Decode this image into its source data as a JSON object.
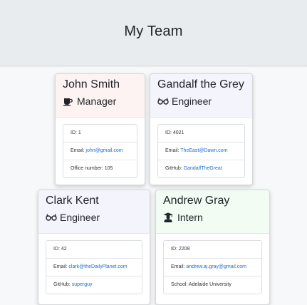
{
  "header": {
    "title": "My Team"
  },
  "cards": [
    {
      "name": "John Smith",
      "role": "Manager",
      "role_icon": "coffee-icon",
      "id_label": "ID: ",
      "id": "1",
      "email_label": "Email: ",
      "email": "john@gmail.com",
      "extra_label": "Office number: ",
      "extra": "105"
    },
    {
      "name": "Gandalf the Grey",
      "role": "Engineer",
      "role_icon": "glasses-icon",
      "id_label": "ID: ",
      "id": "4021",
      "email_label": "Email: ",
      "email": "TheEast@Dawn.com",
      "extra_label": "GitHub: ",
      "extra": "GandalfTheGreat"
    },
    {
      "name": "Clark Kent",
      "role": "Engineer",
      "role_icon": "glasses-icon",
      "id_label": "ID: ",
      "id": "42",
      "email_label": "Email: ",
      "email": "clark@theDailyPlanet.com",
      "extra_label": "GitHub: ",
      "extra": "superguy"
    },
    {
      "name": "Andrew Gray",
      "role": "Intern",
      "role_icon": "graduate-icon",
      "id_label": "ID: ",
      "id": "2208",
      "email_label": "Email: ",
      "email": "andrew.aj.gray@gmail.com",
      "extra_label": "School: ",
      "extra": "Adelaide University"
    }
  ],
  "colors": {
    "manager_header": "#fdf3f3",
    "engineer_header": "#f4f4fd",
    "intern_header": "#f2fcf2",
    "link": "#1a6fd6"
  }
}
